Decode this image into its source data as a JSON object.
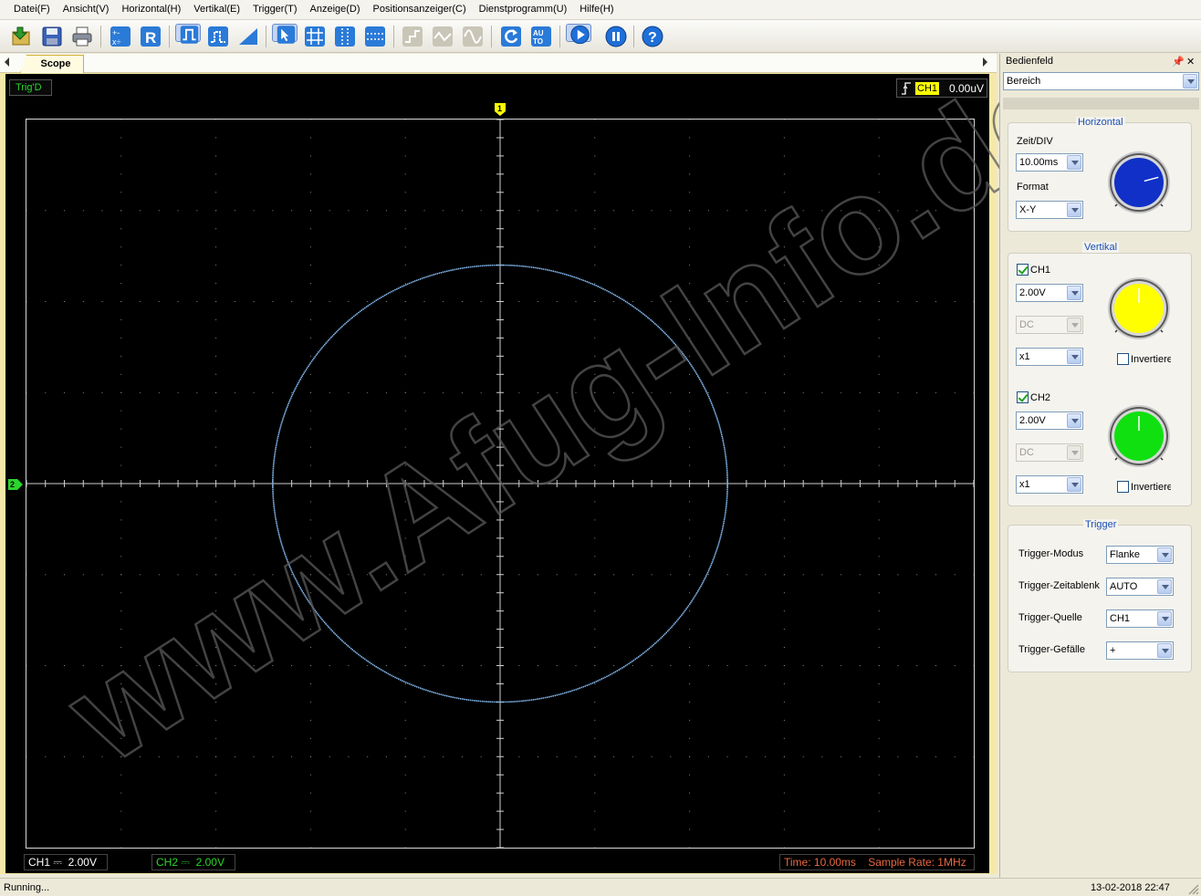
{
  "menu": [
    "Datei(F)",
    "Ansicht(V)",
    "Horizontal(H)",
    "Vertikal(E)",
    "Trigger(T)",
    "Anzeige(D)",
    "Positionsanzeiger(C)",
    "Dienstprogramm(U)",
    "Hilfe(H)"
  ],
  "tabs": {
    "scope": "Scope"
  },
  "scope": {
    "trig_status": "Trig'D",
    "trig_channel": "CH1",
    "trig_level": "0.00uV",
    "ch1_marker": "1",
    "ch2_marker": "2",
    "ch1_status": "CH1",
    "ch1_coupling": "⎓",
    "ch1_scale": "2.00V",
    "ch2_status": "CH2",
    "ch2_coupling": "⎓",
    "ch2_scale": "2.00V",
    "time_status": "Time: 10.00ms",
    "sample_rate": "Sample Rate: 1MHz",
    "watermark": "www.Afug-Info.de"
  },
  "panel": {
    "title": "Bedienfeld",
    "pin_icon": "📌",
    "close_icon": "✕",
    "mode_combo": "Bereich",
    "horizontal": {
      "title": "Horizontal",
      "zeit_label": "Zeit/DIV",
      "zeit_value": "10.00ms",
      "format_label": "Format",
      "format_value": "X-Y",
      "knob_color": "#1030c8"
    },
    "vertikal": {
      "title": "Vertikal",
      "ch1_label": "CH1",
      "ch1_volt": "2.00V",
      "ch1_coupling": "DC",
      "ch1_probe": "x1",
      "ch1_invert": "Invertieren",
      "ch1_knob_color": "#ffff00",
      "ch2_label": "CH2",
      "ch2_volt": "2.00V",
      "ch2_coupling": "DC",
      "ch2_probe": "x1",
      "ch2_invert": "Invertieren",
      "ch2_knob_color": "#10e010"
    },
    "trigger": {
      "title": "Trigger",
      "modus_label": "Trigger-Modus",
      "modus_value": "Flanke",
      "zeitablenk_label": "Trigger-Zeitablenk",
      "zeitablenk_value": "AUTO",
      "quelle_label": "Trigger-Quelle",
      "quelle_value": "CH1",
      "gefaelle_label": "Trigger-Gefälle",
      "gefaelle_value": "+"
    }
  },
  "status": {
    "left": "Running...",
    "datetime": "13-02-2018  22:47"
  },
  "colors": {
    "trace": "#7fb3e8",
    "ch1": "#ffff00",
    "ch2": "#2bd62b",
    "accent": "#1b4fb3"
  }
}
